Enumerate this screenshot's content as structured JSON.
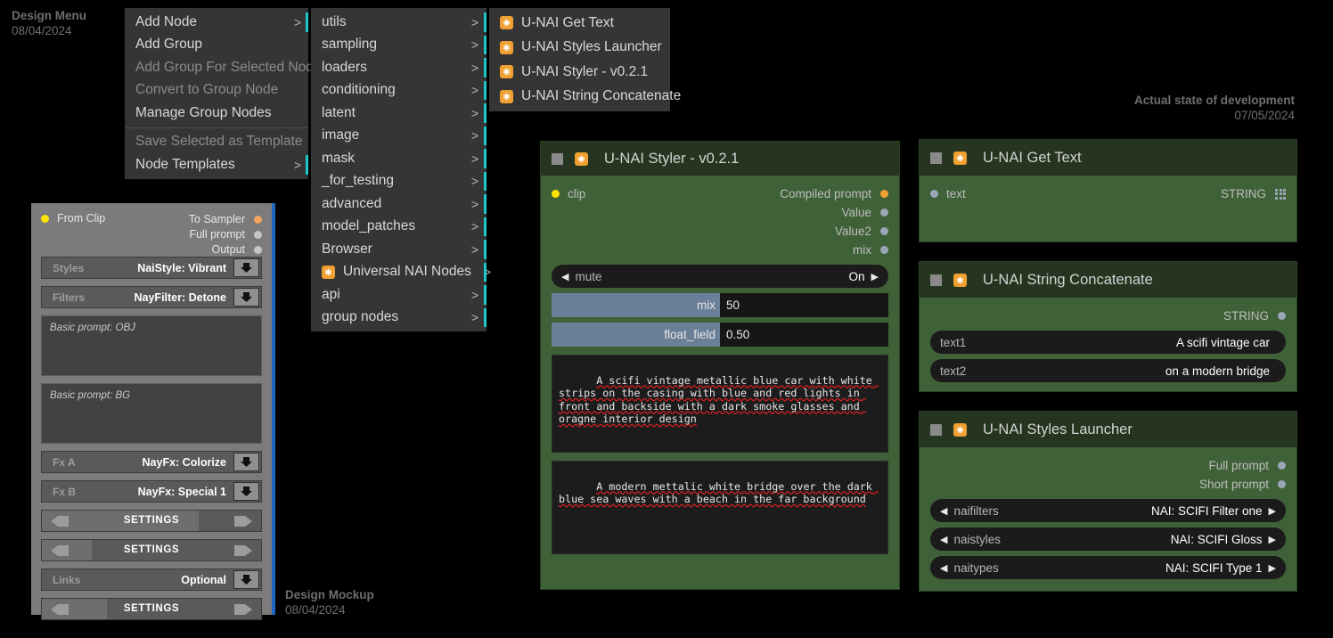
{
  "annotations": {
    "design_menu": {
      "title": "Design Menu",
      "date": "08/04/2024"
    },
    "state": {
      "title": "Actual state of development",
      "date": "07/05/2024"
    },
    "mockup": {
      "title": "Design Mockup",
      "date": "08/04/2024"
    }
  },
  "menu": {
    "column1": [
      {
        "label": "Add Node",
        "arrow": ">",
        "dim": false,
        "sep_after": false
      },
      {
        "label": "Add Group",
        "arrow": "",
        "dim": false,
        "sep_after": false
      },
      {
        "label": "Add Group For Selected Nodes",
        "arrow": "",
        "dim": true,
        "sep_after": false
      },
      {
        "label": "Convert to Group Node",
        "arrow": "",
        "dim": true,
        "sep_after": false
      },
      {
        "label": "Manage Group Nodes",
        "arrow": "",
        "dim": false,
        "sep_after": true
      },
      {
        "label": "Save Selected as Template",
        "arrow": "",
        "dim": true,
        "sep_after": false
      },
      {
        "label": "Node Templates",
        "arrow": ">",
        "dim": false,
        "sep_after": false
      }
    ],
    "column2": [
      {
        "label": "utils",
        "arrow": ">",
        "badge": false
      },
      {
        "label": "sampling",
        "arrow": ">",
        "badge": false
      },
      {
        "label": "loaders",
        "arrow": ">",
        "badge": false
      },
      {
        "label": "conditioning",
        "arrow": ">",
        "badge": false
      },
      {
        "label": "latent",
        "arrow": ">",
        "badge": false
      },
      {
        "label": "image",
        "arrow": ">",
        "badge": false
      },
      {
        "label": "mask",
        "arrow": ">",
        "badge": false
      },
      {
        "label": "_for_testing",
        "arrow": ">",
        "badge": false
      },
      {
        "label": "advanced",
        "arrow": ">",
        "badge": false
      },
      {
        "label": "model_patches",
        "arrow": ">",
        "badge": false
      },
      {
        "label": "Browser",
        "arrow": ">",
        "badge": false
      },
      {
        "label": "Universal NAI Nodes",
        "arrow": ">",
        "badge": true
      },
      {
        "label": "api",
        "arrow": ">",
        "badge": false
      },
      {
        "label": "group nodes",
        "arrow": ">",
        "badge": false
      }
    ],
    "column3": [
      {
        "label": "U-NAI Get Text",
        "badge": true
      },
      {
        "label": "U-NAI Styles Launcher",
        "badge": true
      },
      {
        "label": "U-NAI Styler - v0.2.1",
        "badge": true
      },
      {
        "label": "U-NAI String Concatenate",
        "badge": true
      }
    ]
  },
  "mockup": {
    "input_port": {
      "label": "From Clip",
      "color": "#ffe500"
    },
    "output_ports": [
      {
        "label": "To Sampler",
        "color": "#f2a25c"
      },
      {
        "label": "Full prompt",
        "color": "#c6c6c6"
      },
      {
        "label": "Output",
        "color": "#c6c6c6"
      }
    ],
    "widgets": [
      {
        "type": "combo",
        "name": "Styles",
        "value": "NaiStyle: Vibrant"
      },
      {
        "type": "combo",
        "name": "Filters",
        "value": "NayFilter: Detone"
      }
    ],
    "textareas": [
      {
        "placeholder": "Basic prompt: OBJ"
      },
      {
        "placeholder": "Basic prompt: BG"
      }
    ],
    "fx_widgets": [
      {
        "type": "combo",
        "name": "Fx A",
        "value": "NayFx: Colorize"
      },
      {
        "type": "combo",
        "name": "Fx B",
        "value": "NayFx: Special 1"
      }
    ],
    "settings_rows": [
      {
        "label": "SETTINGS",
        "highlight_pct": 68
      },
      {
        "label": "SETTINGS",
        "highlight_pct": 19
      }
    ],
    "links_widget": {
      "name": "Links",
      "value": "Optional"
    },
    "settings_row_last": {
      "label": "SETTINGS",
      "highlight_pct": 26
    }
  },
  "nodes": {
    "styler": {
      "title": "U-NAI Styler - v0.2.1",
      "input": {
        "label": "clip",
        "color": "#ffe500"
      },
      "outputs": [
        {
          "label": "Compiled prompt",
          "color": "#f0a030"
        },
        {
          "label": "Value",
          "color": "#9aa6b5"
        },
        {
          "label": "Value2",
          "color": "#9aa6b5"
        },
        {
          "label": "mix",
          "color": "#9aa6b5"
        }
      ],
      "combo": {
        "name": "mute",
        "value": "On",
        "left_arrow": "◀",
        "right_arrow": "▶"
      },
      "sliders": [
        {
          "name": "mix",
          "value": "50",
          "fill_pct": 50
        },
        {
          "name": "float_field",
          "value": "0.50",
          "fill_pct": 50
        }
      ],
      "prompt1": "A scifi vintage metallic blue car with white strips on the casing with blue and red lights in front and backside with a dark smoke glasses and oragne interior design",
      "prompt2": "A modern mettalic white bridge over the dark blue sea waves with a beach in the far background"
    },
    "get_text": {
      "title": "U-NAI Get Text",
      "input": {
        "label": "text",
        "color": "#9aa6b5"
      },
      "output_type": "STRING"
    },
    "string_concat": {
      "title": "U-NAI String Concatenate",
      "output_type": "STRING",
      "widgets": [
        {
          "name": "text1",
          "value": "A scifi vintage car"
        },
        {
          "name": "text2",
          "value": "on a modern bridge"
        }
      ]
    },
    "styles_launcher": {
      "title": "U-NAI Styles Launcher",
      "outputs": [
        {
          "label": "Full prompt",
          "color": "#9aa6b5"
        },
        {
          "label": "Short prompt",
          "color": "#9aa6b5"
        }
      ],
      "combos": [
        {
          "name": "naifilters",
          "value": "NAI: SCIFI Filter one"
        },
        {
          "name": "naistyles",
          "value": "NAI: SCIFI Gloss"
        },
        {
          "name": "naitypes",
          "value": "NAI: SCIFI Type 1"
        }
      ]
    }
  },
  "colors": {
    "node_body": "#3f6137",
    "node_header": "#25351f",
    "menu_bg": "#353535",
    "accent_cyan": "#1ec8c8",
    "accent_blue": "#1f66c0",
    "badge_orange": "#f0a030"
  }
}
